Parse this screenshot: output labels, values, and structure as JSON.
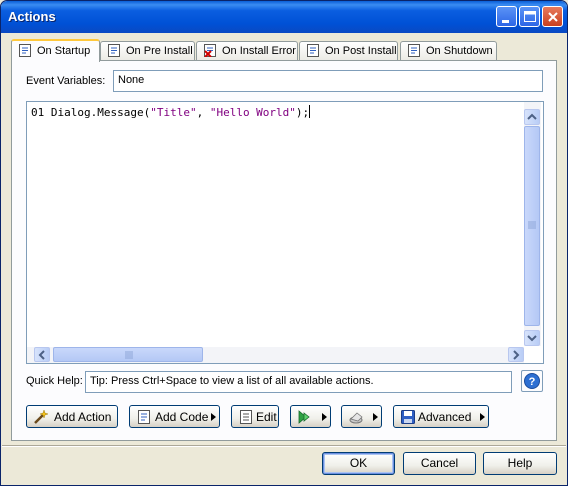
{
  "window": {
    "title": "Actions"
  },
  "tabs": [
    {
      "label": "On Startup",
      "icon": "script-icon",
      "active": true
    },
    {
      "label": "On Pre Install",
      "icon": "script-icon"
    },
    {
      "label": "On Install Error",
      "icon": "script-error-icon"
    },
    {
      "label": "On Post Install",
      "icon": "script-icon"
    },
    {
      "label": "On Shutdown",
      "icon": "script-icon"
    }
  ],
  "event_variables": {
    "label": "Event Variables:",
    "value": "None"
  },
  "editor": {
    "line_number": "01",
    "code_prefix": "Dialog.Message(",
    "arg1": "\"Title\"",
    "sep": ", ",
    "arg2": "\"Hello World\"",
    "code_suffix": ");"
  },
  "quick_help": {
    "label": "Quick Help:",
    "text": "Tip: Press Ctrl+Space to view a list of all available actions."
  },
  "toolbar": {
    "add_action_label": "Add Action",
    "add_code_label": "Add Code",
    "edit_label": "Edit",
    "advanced_label": "Advanced"
  },
  "dialog_buttons": {
    "ok": "OK",
    "cancel": "Cancel",
    "help": "Help"
  },
  "colors": {
    "title_bar": "#0054e3",
    "tab_highlight": "#ffc83c",
    "string_literal": "#800080",
    "dialog_bg": "#ece9d8"
  }
}
